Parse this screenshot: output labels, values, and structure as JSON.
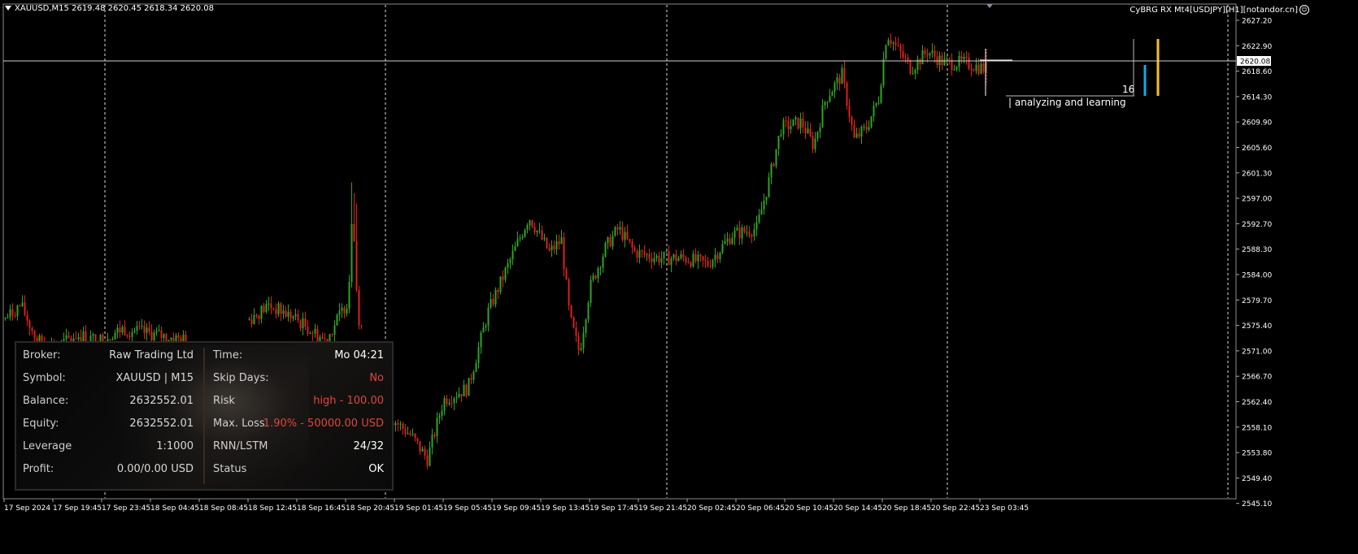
{
  "header": {
    "symbol_text": "XAUUSD,M15  2619.48 2620.45 2618.34 2620.08",
    "ea_text": "CyBRG RX Mt4[USDJPY][H1][notandor.cn]"
  },
  "price_axis": {
    "labels": [
      "2627.20",
      "2622.90",
      "2618.60",
      "2614.30",
      "2609.90",
      "2605.60",
      "2601.30",
      "2597.00",
      "2592.70",
      "2588.30",
      "2584.00",
      "2579.70",
      "2575.40",
      "2571.00",
      "2566.70",
      "2562.40",
      "2558.10",
      "2553.80",
      "2549.40",
      "2545.10"
    ],
    "current_price": "2620.08"
  },
  "time_axis": {
    "labels": [
      "17 Sep 2024",
      "17 Sep 19:45",
      "17 Sep 23:45",
      "18 Sep 04:45",
      "18 Sep 08:45",
      "18 Sep 12:45",
      "18 Sep 16:45",
      "18 Sep 20:45",
      "19 Sep 01:45",
      "19 Sep 05:45",
      "19 Sep 09:45",
      "19 Sep 13:45",
      "19 Sep 17:45",
      "19 Sep 21:45",
      "20 Sep 02:45",
      "20 Sep 06:45",
      "20 Sep 10:45",
      "20 Sep 14:45",
      "20 Sep 18:45",
      "20 Sep 22:45",
      "23 Sep 03:45"
    ]
  },
  "overlay": {
    "bar_count": "16",
    "status_text": "| analyzing and learning"
  },
  "colors": {
    "bull": "#2ea620",
    "bear": "#e0201a",
    "grid": "#ffffff",
    "blue_bar": "#17a8e6",
    "yellow_bar": "#f2c31b"
  },
  "panel": {
    "left": [
      {
        "label": "Broker:",
        "value": "Raw Trading Ltd"
      },
      {
        "label": "Symbol:",
        "value": "XAUUSD | M15"
      },
      {
        "label": "Balance:",
        "value": "2632552.01"
      },
      {
        "label": "Equity:",
        "value": "2632552.01"
      },
      {
        "label": "Leverage",
        "value": "1:1000"
      },
      {
        "label": "Profit:",
        "value": "0.00/0.00 USD"
      }
    ],
    "right": [
      {
        "label": "Time:",
        "value": "Mo 04:21",
        "tone": "white"
      },
      {
        "label": "Skip Days:",
        "value": "No",
        "tone": "red"
      },
      {
        "label": "Risk",
        "value": "high - 100.00",
        "tone": "red"
      },
      {
        "label": "Max. Loss",
        "value": "1.90% - 50000.00 USD",
        "tone": "red"
      },
      {
        "label": "RNN/LSTM",
        "value": "24/32",
        "tone": "white"
      },
      {
        "label": "Status",
        "value": "OK",
        "tone": "white"
      }
    ]
  }
}
